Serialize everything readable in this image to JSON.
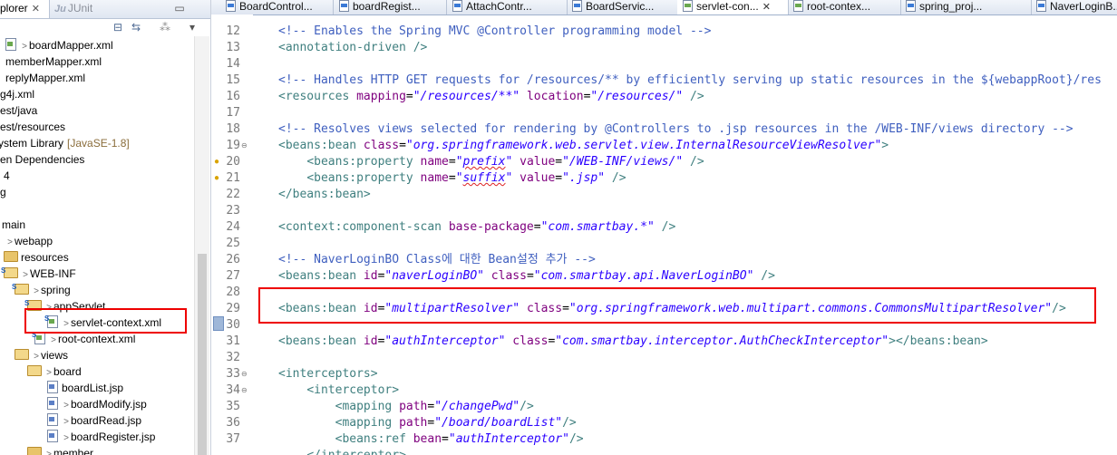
{
  "explorer": {
    "tab_label": "plorer",
    "junit_label": "JUnit",
    "tree": [
      {
        "label": "boardMapper.xml",
        "arrow": ">"
      },
      {
        "label": "memberMapper.xml"
      },
      {
        "label": "replyMapper.xml"
      },
      {
        "label": "g4j.xml"
      },
      {
        "label": "est/java"
      },
      {
        "label": "est/resources"
      },
      {
        "label": "ystem Library",
        "suffix": "[JavaSE-1.8]"
      },
      {
        "label": "en Dependencies"
      },
      {
        "label": "4"
      },
      {
        "label": "g"
      },
      {
        "label": "main"
      },
      {
        "label": "webapp",
        "arrow": ">"
      },
      {
        "label": "resources"
      },
      {
        "label": "WEB-INF",
        "arrow": ">"
      },
      {
        "label": "spring",
        "arrow": ">"
      },
      {
        "label": "appServlet",
        "arrow": ">"
      },
      {
        "label": "servlet-context.xml",
        "arrow": ">"
      },
      {
        "label": "root-context.xml",
        "arrow": ">"
      },
      {
        "label": "views",
        "arrow": ">"
      },
      {
        "label": "board",
        "arrow": ">"
      },
      {
        "label": "boardList.jsp"
      },
      {
        "label": "boardModify.jsp",
        "arrow": ">"
      },
      {
        "label": "boardRead.jsp",
        "arrow": ">"
      },
      {
        "label": "boardRegister.jsp",
        "arrow": ">"
      },
      {
        "label": "member",
        "arrow": ">"
      }
    ]
  },
  "editor": {
    "tabs": [
      {
        "label": "BoardControl...",
        "kind": "java"
      },
      {
        "label": "boardRegist...",
        "kind": "java"
      },
      {
        "label": "AttachContr...",
        "kind": "java"
      },
      {
        "label": "BoardServic...",
        "kind": "java"
      },
      {
        "label": "servlet-con...",
        "kind": "xml",
        "active": true
      },
      {
        "label": "root-contex...",
        "kind": "xml"
      },
      {
        "label": "spring_proj...",
        "kind": "java"
      },
      {
        "label": "NaverLoginB...",
        "kind": "java"
      }
    ],
    "line_numbers": [
      "12",
      "13",
      "14",
      "15",
      "16",
      "17",
      "18",
      "19",
      "20",
      "21",
      "22",
      "23",
      "24",
      "25",
      "26",
      "27",
      "28",
      "29",
      "30",
      "31",
      "32",
      "33",
      "34",
      "35",
      "36",
      "37"
    ],
    "code_lines": [
      "<!-- Enables the Spring MVC @Controller programming model -->",
      "<annotation-driven />",
      "",
      "<!-- Handles HTTP GET requests for /resources/** by efficiently serving up static resources in the ${webappRoot}/res",
      "<resources mapping=\"/resources/**\" location=\"/resources/\" />",
      "",
      "<!-- Resolves views selected for rendering by @Controllers to .jsp resources in the /WEB-INF/views directory -->",
      "<beans:bean class=\"org.springframework.web.servlet.view.InternalResourceViewResolver\">",
      "    <beans:property name=\"prefix\" value=\"/WEB-INF/views/\" />",
      "    <beans:property name=\"suffix\" value=\".jsp\" />",
      "</beans:bean>",
      "",
      "<context:component-scan base-package=\"com.smartbay.*\" />",
      "",
      "<!-- NaverLoginBO Class에 대한 Bean설정 추가 -->",
      "<beans:bean id=\"naverLoginBO\" class=\"com.smartbay.api.NaverLoginBO\" />",
      "",
      "<beans:bean id=\"multipartResolver\" class=\"org.springframework.web.multipart.commons.CommonsMultipartResolver\"/>",
      "",
      "<beans:bean id=\"authInterceptor\" class=\"com.smartbay.interceptor.AuthCheckInterceptor\"></beans:bean>",
      "",
      "<interceptors>",
      "    <interceptor>",
      "        <mapping path=\"/changePwd\"/>",
      "        <mapping path=\"/board/boardList\"/>",
      "        <beans:ref bean=\"authInterceptor\"/>",
      "    </interceptor>"
    ]
  },
  "colors": {
    "comment": "#3f5fbf",
    "tag": "#3f7f7f",
    "attribute": "#7f007f",
    "value": "#2a00ff",
    "highlight_box": "#e00000"
  }
}
